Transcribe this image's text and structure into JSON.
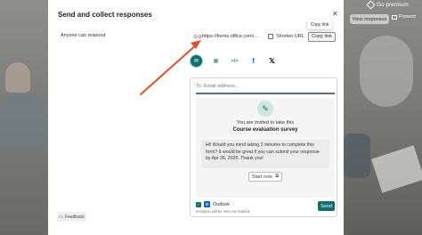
{
  "header": {
    "go_premium": "Go premium",
    "view_responses": "View responses",
    "present": "Present"
  },
  "modal": {
    "title": "Send and collect responses",
    "tooltip": "Copy link",
    "permission": "Anyone can respond",
    "link": "https://forms.office.com/Pag...",
    "shorten_url": "Shorten URL",
    "copy_link": "Copy link",
    "share_icons": [
      "email-icon",
      "qr-code-icon",
      "embed-icon",
      "facebook-icon",
      "x-icon"
    ]
  },
  "email_card": {
    "to_placeholder": "To: Email address...",
    "invited_text": "You are invited to take this",
    "survey_title": "Course evaluation survey",
    "message": "Hi! Would you mind taking 2 minutes to complete this form? It would be great if you can submit your response by Apr 26, 2025. Thank you!",
    "start_now": "Start now",
    "outlook_label": "Outlook",
    "outlook_note": "Invitation will be sent via Outlook",
    "send": "Send"
  },
  "footer": {
    "feedback": "Feedback"
  },
  "colors": {
    "accent": "#0f6e6e",
    "annotation_arrow": "#e0502a"
  }
}
